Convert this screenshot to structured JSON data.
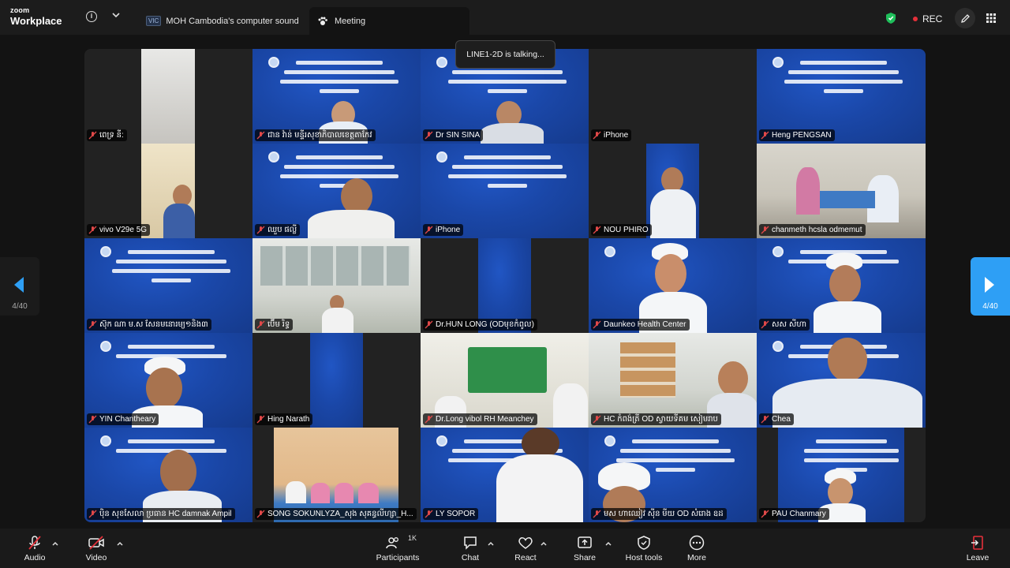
{
  "app": {
    "brand_top": "zoom",
    "brand_bottom": "Workplace"
  },
  "tabs": [
    {
      "label": "MOH Cambodia's computer sound",
      "badge": "VIC"
    },
    {
      "label": "Meeting"
    }
  ],
  "recording": {
    "label": "REC"
  },
  "talking_banner": "LINE1-2D is talking...",
  "pager": {
    "left_label": "4/40",
    "right_label": "4/40"
  },
  "participants": [
    {
      "name": "ពេទ្រ នី:"
    },
    {
      "name": "ជាន វ៉ាន់ មន្ទីរសុខាភិបាលខេត្តតាកែវ"
    },
    {
      "name": "Dr SIN SINA"
    },
    {
      "name": "iPhone"
    },
    {
      "name": "Heng PENGSAN"
    },
    {
      "name": "vivo V29e 5G"
    },
    {
      "name": "ឈួប ផល្លី"
    },
    {
      "name": "iPhone"
    },
    {
      "name": "NOU PHIRO"
    },
    {
      "name": "chanmeth hcsla odmemut"
    },
    {
      "name": "ស៊ុក ណា ម.ស សែនមនោរម្យ១និង៣"
    },
    {
      "name": "ប៊ើម រិទ្ធ"
    },
    {
      "name": "Dr.HUN LONG (ODមុខកំពូល)"
    },
    {
      "name": "Daunkeo Health Center"
    },
    {
      "name": "សស សីហា"
    },
    {
      "name": "YIN Chantheary"
    },
    {
      "name": "Hing Narath"
    },
    {
      "name": "Dr.Long vibol RH Meanchey"
    },
    {
      "name": "HC កំពង់ត្រី OD ស្វាយទីគម សៀមរាប"
    },
    {
      "name": "Chea"
    },
    {
      "name": "ប៉ិន សុខសែលា ប្រធាន HC damnak Ampil"
    },
    {
      "name": "SONG SOKUNLYZA_សុង សុគន្ធលីហ្សា_H..."
    },
    {
      "name": "LY SOPOR"
    },
    {
      "name": "មស ហាឈៀវ ស៊ីន មីយ OD សំរោង ឧដ"
    },
    {
      "name": "PAU Chanmary"
    }
  ],
  "toolbar": {
    "audio": "Audio",
    "video": "Video",
    "participants": "Participants",
    "participants_count": "1K",
    "chat": "Chat",
    "react": "React",
    "share": "Share",
    "host_tools": "Host tools",
    "more": "More",
    "leave": "Leave"
  },
  "colors": {
    "accent": "#2e9ff5",
    "rec": "#e5303a",
    "leave": "#e5303a",
    "slide_blue": "#1a47a8"
  }
}
